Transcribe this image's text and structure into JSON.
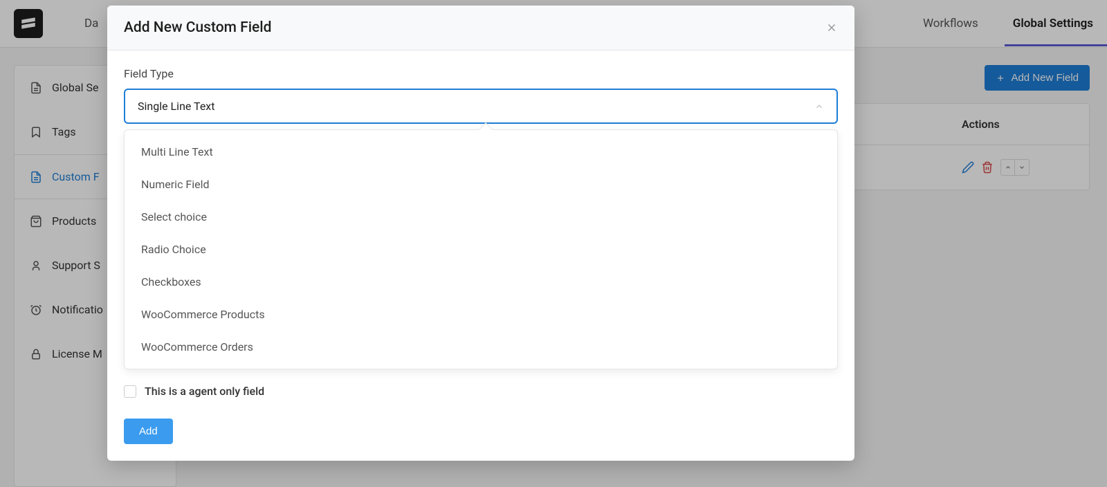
{
  "header": {
    "nav_left": "Da",
    "nav_right": [
      {
        "label": "Workflows",
        "active": false
      },
      {
        "label": "Global Settings",
        "active": true
      }
    ]
  },
  "sidebar": {
    "items": [
      {
        "icon": "document-icon",
        "label": "Global Se"
      },
      {
        "icon": "bookmark-icon",
        "label": "Tags"
      },
      {
        "icon": "document-icon",
        "label": "Custom F",
        "active": true
      },
      {
        "icon": "bag-icon",
        "label": "Products"
      },
      {
        "icon": "user-icon",
        "label": "Support S"
      },
      {
        "icon": "clock-icon",
        "label": "Notificatio"
      },
      {
        "icon": "lock-icon",
        "label": "License M"
      }
    ]
  },
  "content": {
    "add_button": "Add New Field",
    "table": {
      "headers": {
        "actions": "Actions"
      }
    }
  },
  "modal": {
    "title": "Add New Custom Field",
    "field_type_label": "Field Type",
    "selected_value": "Single Line Text",
    "options": [
      "Multi Line Text",
      "Numeric Field",
      "Select choice",
      "Radio Choice",
      "Checkboxes",
      "WooCommerce Products",
      "WooCommerce Orders"
    ],
    "agent_only_label": "This is a agent only field",
    "add_button": "Add"
  }
}
